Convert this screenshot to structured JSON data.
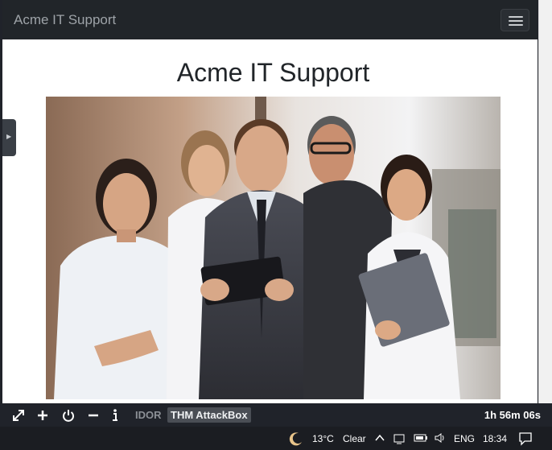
{
  "site": {
    "brand": "Acme IT Support",
    "heading": "Acme IT Support",
    "menu_icon": "hamburger-menu-icon",
    "photo_description_icon": "team-photo"
  },
  "control_bar": {
    "tag_idor": "IDOR",
    "tag_thm": "THM AttackBox",
    "timer": "1h 56m 06s",
    "icons": [
      "fullscreen-icon",
      "plus-icon",
      "power-icon",
      "minus-icon",
      "info-icon"
    ]
  },
  "taskbar": {
    "weather_temp": "13°C",
    "weather_text": "Clear",
    "language": "ENG",
    "time": "18:34",
    "icons": [
      "moon-weather-icon",
      "chevron-up-icon",
      "network-icon",
      "battery-icon",
      "speaker-icon",
      "notification-icon"
    ]
  },
  "colors": {
    "navbar": "#212529",
    "bar_background": "#20232a",
    "page_background": "#ffffff"
  }
}
